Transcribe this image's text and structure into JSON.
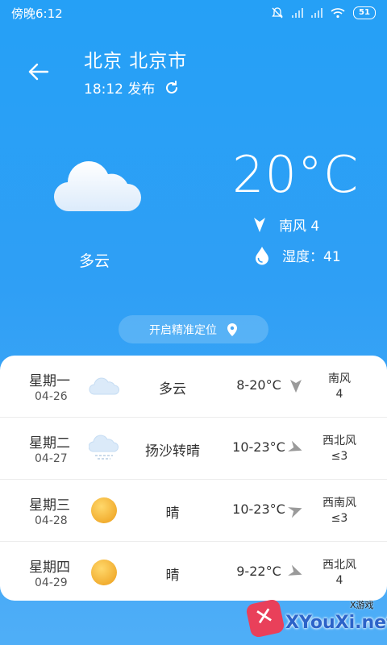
{
  "status_bar": {
    "time": "傍晚6:12",
    "battery": "51"
  },
  "header": {
    "city": "北京 北京市",
    "publish_time": "18:12 发布"
  },
  "current": {
    "temperature": "20°C",
    "condition": "多云",
    "wind": "南风  4",
    "humidity": "湿度：41"
  },
  "locate_button": {
    "label": "开启精准定位"
  },
  "forecast": [
    {
      "day": "星期一",
      "date": "04-26",
      "icon": "cloud-icon",
      "condition": "多云",
      "range": "8-20°C",
      "wind_dir": "南风",
      "wind_level": "4"
    },
    {
      "day": "星期二",
      "date": "04-27",
      "icon": "dust-cloud-icon",
      "condition": "扬沙转晴",
      "range": "10-23°C",
      "wind_dir": "西北风",
      "wind_level": "≤3"
    },
    {
      "day": "星期三",
      "date": "04-28",
      "icon": "sun-icon",
      "condition": "晴",
      "range": "10-23°C",
      "wind_dir": "西南风",
      "wind_level": "≤3"
    },
    {
      "day": "星期四",
      "date": "04-29",
      "icon": "sun-icon",
      "condition": "晴",
      "range": "9-22°C",
      "wind_dir": "西北风",
      "wind_level": "4"
    }
  ],
  "watermark": {
    "site": "XYouXi.net",
    "tag": "X游戏"
  },
  "colors": {
    "background": "#25a0f6",
    "card": "#ffffff",
    "sun": "#f5b731"
  }
}
